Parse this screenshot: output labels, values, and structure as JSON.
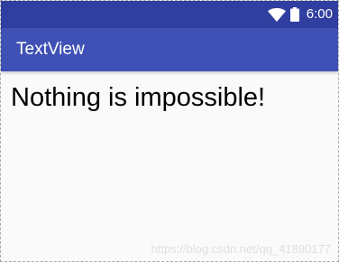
{
  "status_bar": {
    "time": "6:00",
    "icons": [
      "wifi-icon",
      "battery-icon"
    ],
    "color": "#303f9f"
  },
  "app_bar": {
    "title": "TextView",
    "color": "#3f51b5"
  },
  "content": {
    "text": "Nothing is impossible!"
  },
  "watermark": {
    "text": "https://blog.csdn.net/qq_41890177"
  }
}
